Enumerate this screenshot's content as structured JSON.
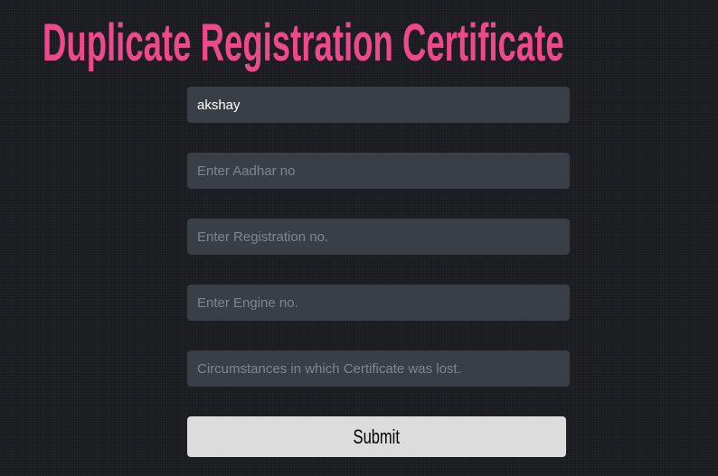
{
  "title": "Duplicate Registration Certificate",
  "form": {
    "name": {
      "value": "akshay",
      "placeholder": ""
    },
    "aadhar": {
      "value": "",
      "placeholder": "Enter Aadhar no"
    },
    "registration": {
      "value": "",
      "placeholder": "Enter Registration no."
    },
    "engine": {
      "value": "",
      "placeholder": "Enter Engine no."
    },
    "circumstances": {
      "value": "",
      "placeholder": "Circumstances in which Certificate was lost."
    },
    "submit_label": "Submit"
  },
  "colors": {
    "title": "#ec4a8a",
    "background": "#1a1c21",
    "input_bg": "#3a3f47",
    "button_bg": "#dcdcdc"
  }
}
